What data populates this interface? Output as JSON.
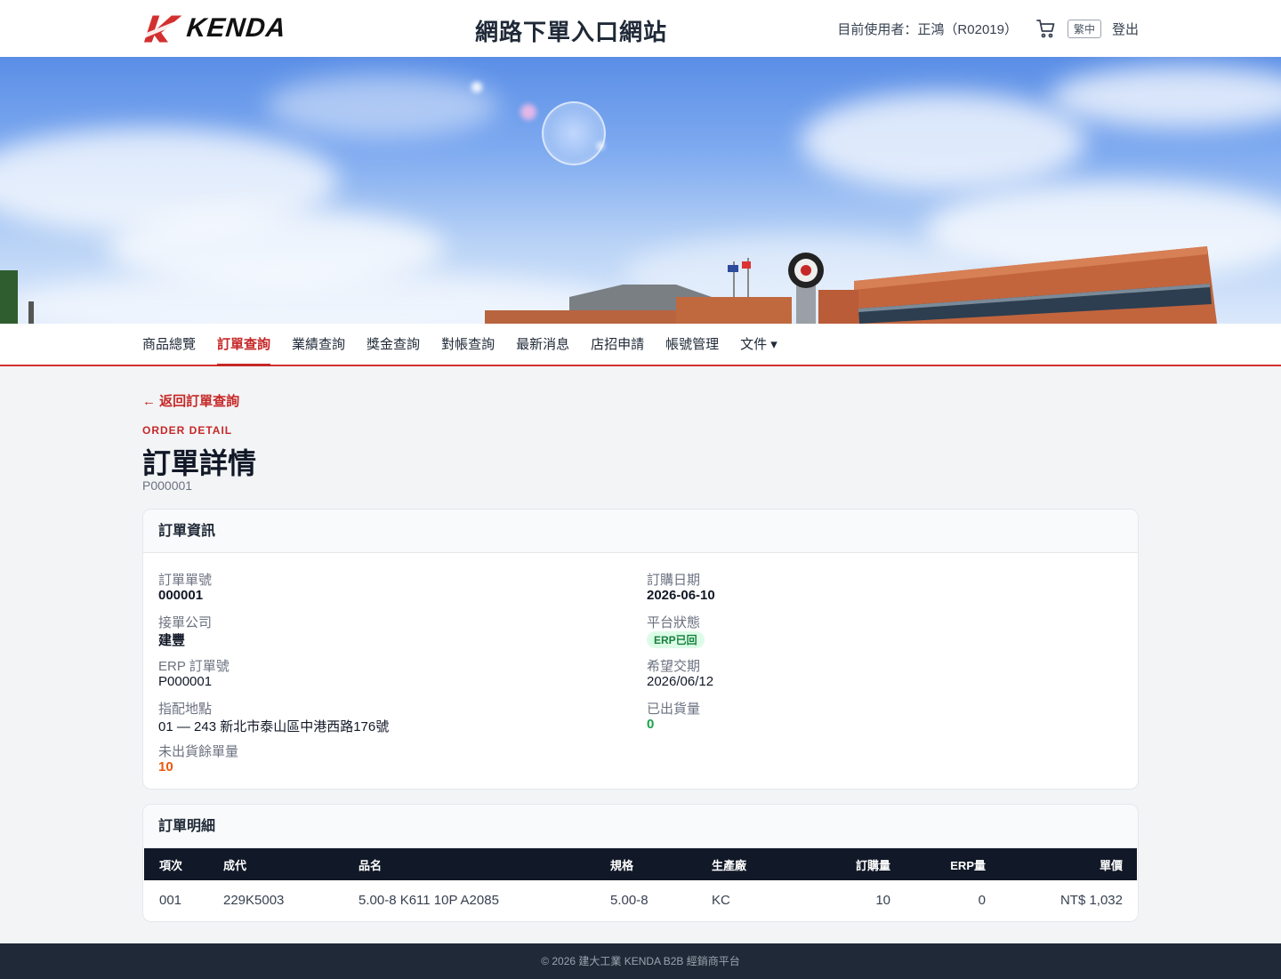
{
  "header": {
    "logo_text": "KENDA",
    "site_title": "網路下單入口網站",
    "user_label": "目前使用者：正鴻（R02019）",
    "lang_label": "繁中",
    "logout_label": "登出"
  },
  "nav": {
    "items": [
      {
        "label": "商品總覽"
      },
      {
        "label": "訂單查詢",
        "active": true
      },
      {
        "label": "業績查詢"
      },
      {
        "label": "獎金查詢"
      },
      {
        "label": "對帳查詢"
      },
      {
        "label": "最新消息"
      },
      {
        "label": "店招申請"
      },
      {
        "label": "帳號管理"
      },
      {
        "label": "文件 ▾"
      }
    ]
  },
  "main": {
    "back_link": "← 返回訂單查詢",
    "eyebrow": "ORDER DETAIL",
    "title": "訂單詳情",
    "subtitle": "P000001"
  },
  "order_info": {
    "heading": "訂單資訊",
    "left": [
      {
        "label": "訂單單號",
        "value": "000001"
      },
      {
        "label": "接單公司",
        "value": "建豐"
      },
      {
        "label": "ERP 訂單號",
        "value": "P000001"
      },
      {
        "label": "指配地點",
        "value": "01 — 243 新北市泰山區中港西路176號"
      },
      {
        "label": "未出貨餘單量",
        "value": "10"
      }
    ],
    "right": [
      {
        "label": "訂購日期",
        "value": "2026-06-10"
      },
      {
        "label": "平台狀態",
        "value": "ERP已回"
      },
      {
        "label": "希望交期",
        "value": "2026/06/12"
      },
      {
        "label": "已出貨量",
        "value": "0"
      }
    ]
  },
  "order_detail": {
    "heading": "訂單明細",
    "columns": [
      "項次",
      "成代",
      "品名",
      "規格",
      "生產廠",
      "訂購量",
      "ERP量",
      "單價"
    ],
    "rows": [
      [
        "001",
        "229K5003",
        "5.00-8 K611 10P A2085",
        "5.00-8",
        "KC",
        "10",
        "0",
        "NT$ 1,032"
      ]
    ]
  },
  "footer": {
    "text": "© 2026 建大工業 KENDA B2B 經銷商平台"
  },
  "colors": {
    "accent": "#c62828",
    "dark": "#111827",
    "success": "#16a34a",
    "warning": "#ea580c"
  }
}
